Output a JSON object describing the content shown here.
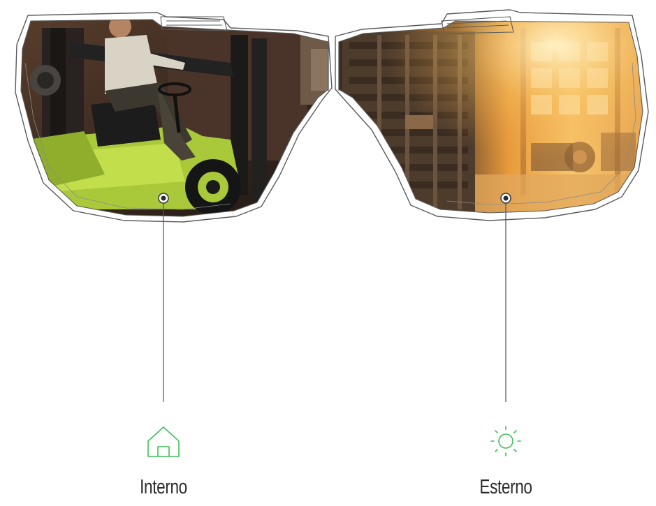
{
  "lenses": [
    {
      "label": "Interno",
      "icon": "home-icon"
    },
    {
      "label": "Esterno",
      "icon": "sun-icon"
    }
  ],
  "colors": {
    "accent": "#3fbf5a",
    "leader_line": "#555555",
    "frame_stroke": "#5a5a5a",
    "text": "#2b2b2b"
  }
}
